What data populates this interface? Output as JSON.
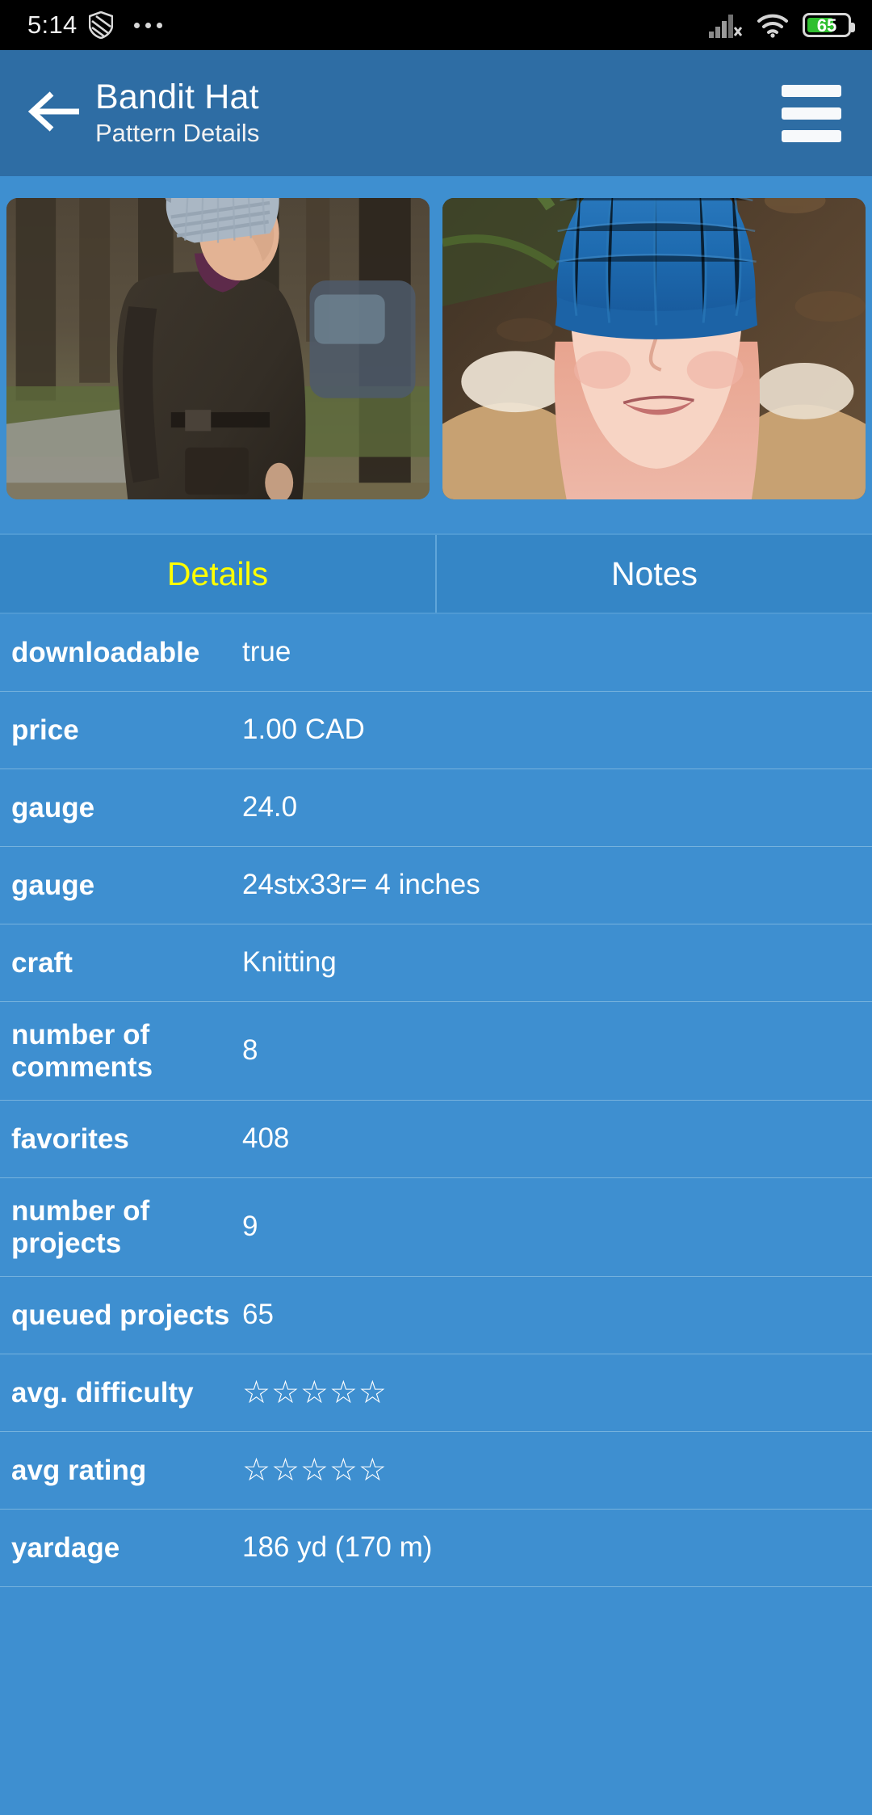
{
  "statusbar": {
    "time": "5:14",
    "shield_icon": "shield-icon",
    "overflow_icon": "more-dots-icon",
    "signal_icon": "cellular-signal-off-icon",
    "wifi_icon": "wifi-icon",
    "battery_icon": "battery-icon",
    "battery_level": "65"
  },
  "appbar": {
    "back_icon": "back-arrow-icon",
    "title": "Bandit Hat",
    "subtitle": "Pattern Details",
    "menu_icon": "hamburger-menu-icon"
  },
  "photos": [
    {
      "name": "pattern-photo-1",
      "alt": "Woman in grey slouchy knit hat and dark parka walking on a tree-lined street"
    },
    {
      "name": "pattern-photo-2",
      "alt": "Smiling woman with pink hair wearing a blue knit beanie in the woods"
    }
  ],
  "tabs": [
    {
      "label": "Details",
      "active": true
    },
    {
      "label": "Notes",
      "active": false
    }
  ],
  "details": [
    {
      "key": "downloadable",
      "value": "true",
      "type": "text"
    },
    {
      "key": "price",
      "value": "1.00 CAD",
      "type": "text"
    },
    {
      "key": "gauge",
      "value": "24.0",
      "type": "text"
    },
    {
      "key": "gauge",
      "value": "24stx33r= 4 inches",
      "type": "text"
    },
    {
      "key": "craft",
      "value": "Knitting",
      "type": "text"
    },
    {
      "key": "number of comments",
      "value": "8",
      "type": "text"
    },
    {
      "key": "favorites",
      "value": "408",
      "type": "text"
    },
    {
      "key": "number of projects",
      "value": "9",
      "type": "text"
    },
    {
      "key": "queued projects",
      "value": "65",
      "type": "text"
    },
    {
      "key": "avg. difficulty",
      "value": "☆☆☆☆☆",
      "type": "stars"
    },
    {
      "key": "avg rating",
      "value": "☆☆☆☆☆",
      "type": "stars"
    },
    {
      "key": "yardage",
      "value": "186 yd (170 m)",
      "type": "text"
    }
  ],
  "colors": {
    "app_bar": "#2e6da4",
    "background": "#3e8fd0",
    "tab_bar": "#3586c6",
    "active_tab_text": "#ffff00",
    "divider": "#76b2dd",
    "battery_green": "#2fbf2f"
  }
}
